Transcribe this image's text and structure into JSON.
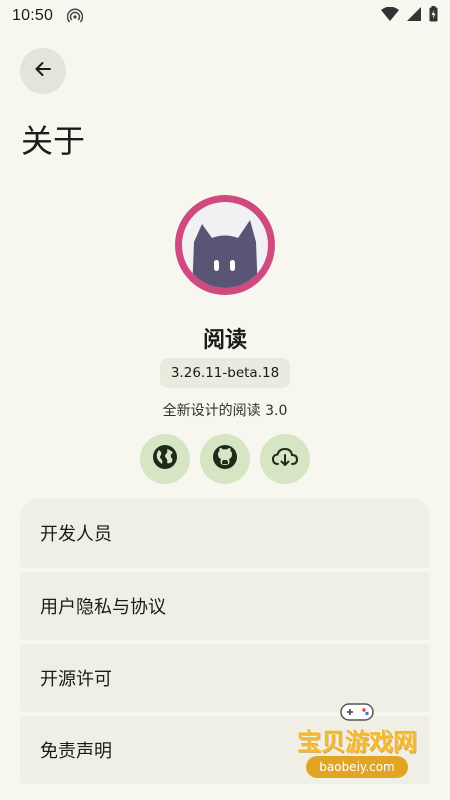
{
  "status_bar": {
    "time": "10:50"
  },
  "header": {
    "title": "关于"
  },
  "app": {
    "name": "阅读",
    "version": "3.26.11-beta.18",
    "description": "全新设计的阅读 3.0"
  },
  "action_icons": [
    "globe-icon",
    "github-icon",
    "cloud-download-icon"
  ],
  "list": {
    "items": [
      {
        "label": "开发人员"
      },
      {
        "label": "用户隐私与协议"
      },
      {
        "label": "开源许可"
      },
      {
        "label": "免责声明"
      }
    ]
  },
  "watermark": {
    "text": "宝贝游戏网",
    "url": "baobeiy.com"
  },
  "colors": {
    "background": "#f7f7f0",
    "avatar_ring": "#d04a80",
    "icon_button": "#d6e6c4",
    "list_item": "#efefe6"
  }
}
